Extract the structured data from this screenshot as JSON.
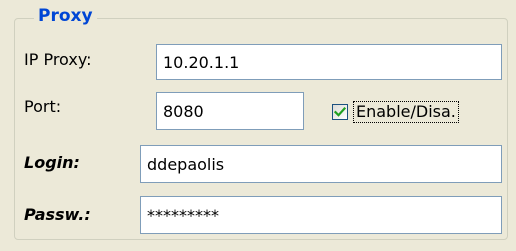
{
  "proxy": {
    "title": "Proxy",
    "ip_label": "IP Proxy:",
    "ip_value": "10.20.1.1",
    "port_label": "Port:",
    "port_value": "8080",
    "enable_label": "Enable/Disa.",
    "enable_checked": true,
    "login_label": "Login:",
    "login_value": "ddepaolis",
    "password_label": "Passw.:",
    "password_value": "*********"
  },
  "colors": {
    "background": "#ece9d8",
    "legend": "#0046d5",
    "input_border": "#7f9db9",
    "check": "#21a121"
  }
}
